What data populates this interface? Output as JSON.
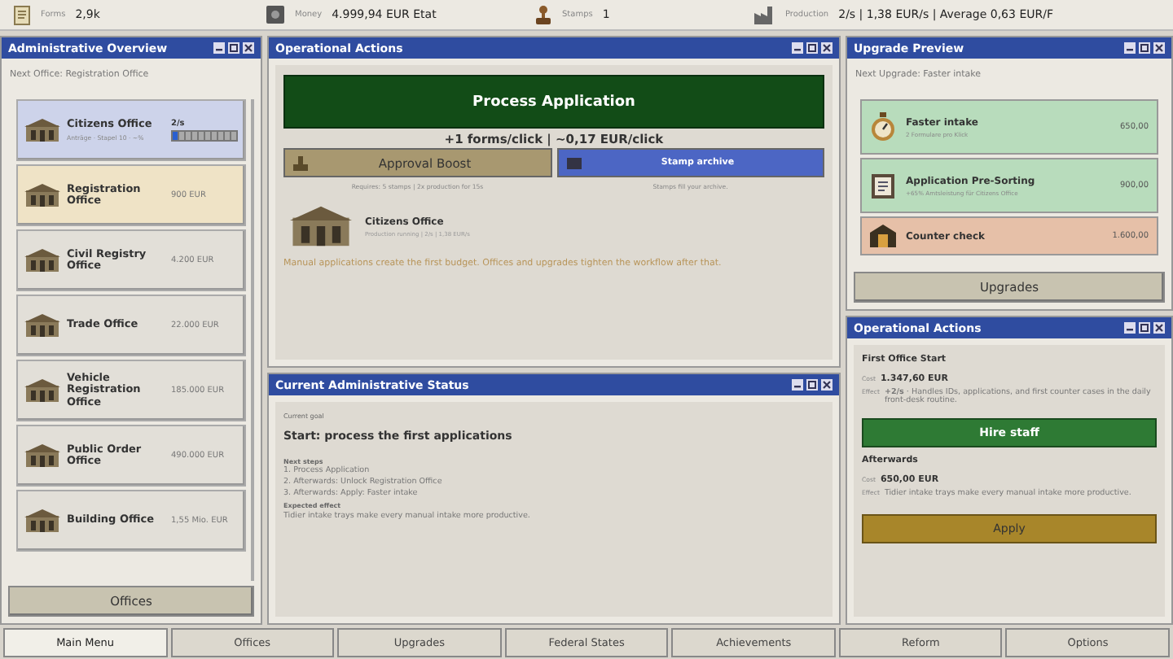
{
  "top_bar": [
    {
      "kind": "forms",
      "label": "Forms",
      "value": "2,9k"
    },
    {
      "kind": "money",
      "label": "Money",
      "value": "4.999,94 EUR Etat"
    },
    {
      "kind": "stamps",
      "label": "Stamps",
      "value": "1"
    },
    {
      "kind": "production",
      "label": "Production",
      "value": "2/s | 1,38 EUR/s | Average 0,63 EUR/F"
    }
  ],
  "overview": {
    "title": "Administrative Overview",
    "next": "Next Office: Registration Office",
    "button": "Offices",
    "offices": [
      {
        "name": "Citizens Office",
        "kind": "active",
        "rate": "2/s",
        "detail": "Anträge · Stapel 10 · ~%",
        "level": 0.1
      },
      {
        "name": "Registration Office",
        "kind": "next",
        "price": "900 EUR"
      },
      {
        "name": "Civil Registry Office",
        "kind": "locked",
        "price": "4.200 EUR"
      },
      {
        "name": "Trade Office",
        "kind": "locked",
        "price": "22.000 EUR"
      },
      {
        "name": "Vehicle Registration Office",
        "kind": "locked",
        "price": "185.000 EUR"
      },
      {
        "name": "Public Order Office",
        "kind": "locked",
        "price": "490.000 EUR"
      },
      {
        "name": "Building Office",
        "kind": "locked",
        "price": "1,55 Mio. EUR"
      }
    ]
  },
  "actions": {
    "title": "Operational Actions",
    "main_button": "Process Application",
    "rate": "+1 forms/click | ~0,17 EUR/click",
    "boost": {
      "label": "Approval Boost",
      "note": "Requires: 5 stamps | 2x production for 15s"
    },
    "archive": {
      "label": "Stamp archive",
      "note": "Stamps fill your archive."
    },
    "office": {
      "name": "Citizens Office",
      "detail": "Production running | 2/s | 1,38 EUR/s"
    },
    "hint": "Manual applications create the first budget. Offices and upgrades tighten the workflow after that."
  },
  "status": {
    "title": "Current Administrative Status",
    "goal_label": "Current goal",
    "goal": "Start: process the first applications",
    "steps_label": "Next steps",
    "steps": [
      "1.  Process Application",
      "2.  Afterwards: Unlock Registration Office",
      "3.  Afterwards: Apply: Faster intake"
    ],
    "effect_label": "Expected effect",
    "effect": "Tidier intake trays make every manual intake more productive."
  },
  "upgrades": {
    "title": "Upgrade Preview",
    "next": "Next Upgrade: Faster intake",
    "button": "Upgrades",
    "items": [
      {
        "kind": "stopwatch",
        "name": "Faster intake",
        "detail": "2 Formulare pro Klick",
        "price": "650,00",
        "affordable": true
      },
      {
        "kind": "clipboard",
        "name": "Application Pre-Sorting",
        "detail": "+65% Amtsleistung für Citizens Office",
        "price": "900,00",
        "affordable": true
      },
      {
        "kind": "booth",
        "name": "Counter check",
        "price": "1.600,00",
        "affordable": false
      }
    ]
  },
  "staff": {
    "title": "Operational Actions",
    "heading": "First Office Start",
    "cost_label": "Cost",
    "cost": "1.347,60 EUR",
    "effect_label": "Effect",
    "effect": "**+2/s** · Handles IDs, applications, and first counter cases in the daily front-desk routine.",
    "button": "Hire staff",
    "after_heading": "Afterwards",
    "after_cost_label": "Cost",
    "after_effect_label": "Effect",
    "after_cost": "650,00 EUR",
    "after_effect": "Tidier intake trays make every manual intake more productive.",
    "after_button": "Apply"
  },
  "nav": [
    {
      "label": "Main Menu",
      "selected": true
    },
    {
      "label": "Offices",
      "selected": false
    },
    {
      "label": "Upgrades",
      "selected": false
    },
    {
      "label": "Federal States",
      "selected": false
    },
    {
      "label": "Achievements",
      "selected": false
    },
    {
      "label": "Reform",
      "selected": false
    },
    {
      "label": "Options",
      "selected": false
    }
  ]
}
